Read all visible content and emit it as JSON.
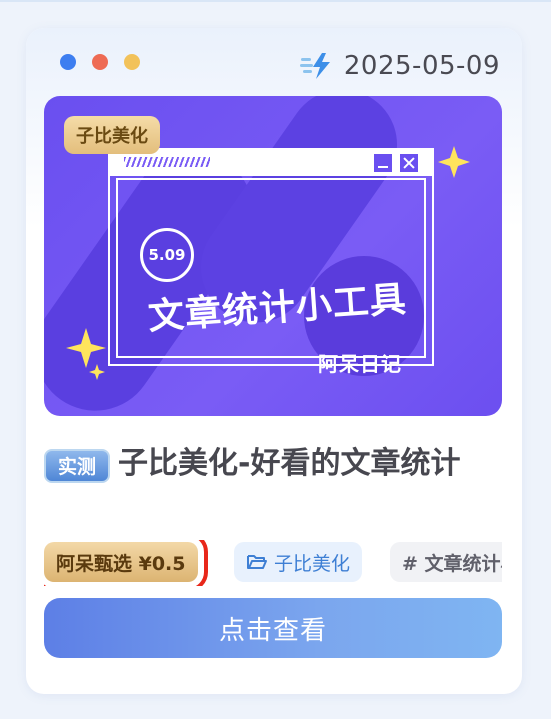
{
  "header": {
    "date": "2025-05-09"
  },
  "banner": {
    "tag": "子比美化",
    "circle_date": "5.09",
    "title": "文章统计小工具",
    "subtitle": "阿呆日记"
  },
  "post": {
    "badge": "实测",
    "title": "子比美化-好看的文章统计"
  },
  "chips": {
    "price": "阿呆甄选 ¥0.5",
    "category": "子比美化",
    "tag": "# 文章统计小"
  },
  "actions": {
    "view_label": "点击查看"
  },
  "colors": {
    "accent": "#6a4ff0",
    "button": "#6d96ec",
    "highlight_box": "#e8271a"
  }
}
